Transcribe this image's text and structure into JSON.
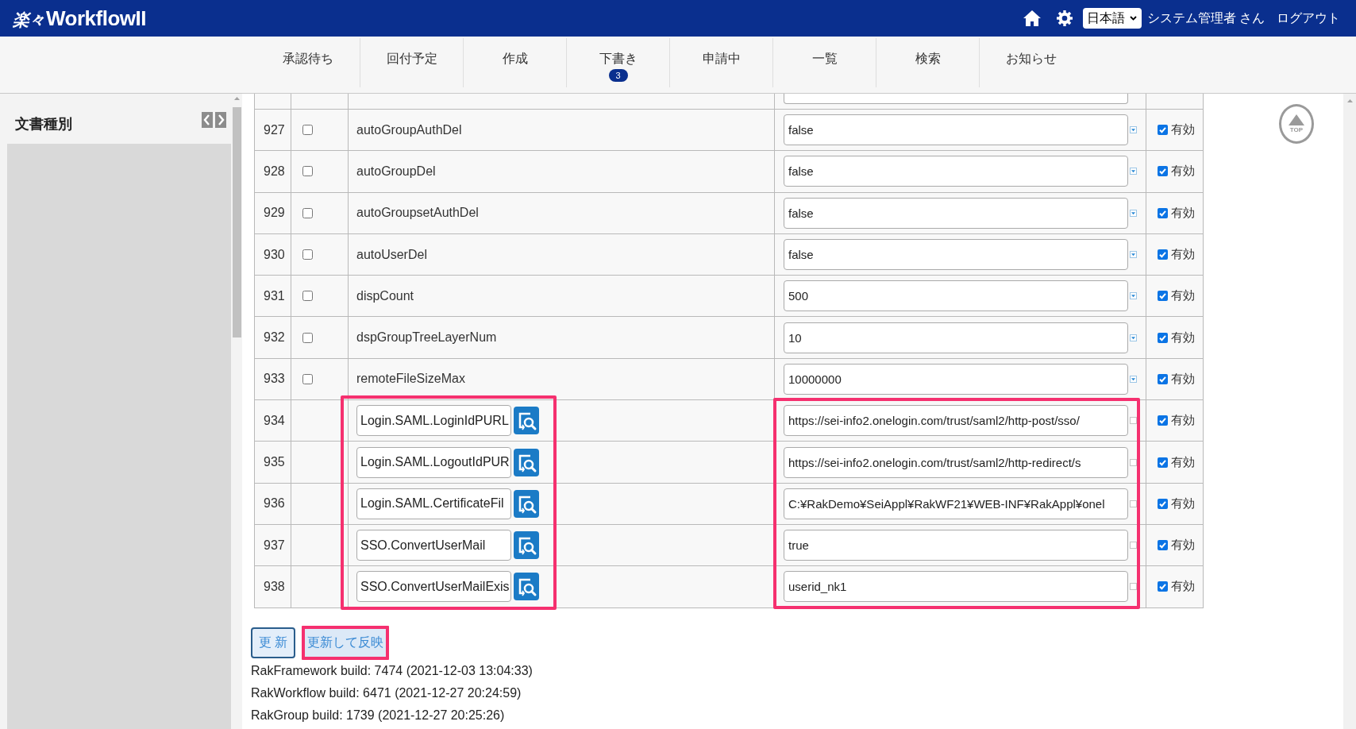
{
  "header": {
    "logo": {
      "mark": "楽々",
      "name": "WorkflowII"
    },
    "language": "日本語",
    "user": "システム管理者 さん",
    "logout": "ログアウト"
  },
  "nav": {
    "tabs": [
      {
        "label": "承認待ち",
        "selected": false
      },
      {
        "label": "回付予定",
        "selected": false
      },
      {
        "label": "作成",
        "selected": false
      },
      {
        "label": "下書き",
        "selected": false,
        "badge": "3"
      },
      {
        "label": "申請中",
        "selected": false
      },
      {
        "label": "一覧",
        "selected": false
      },
      {
        "label": "検索",
        "selected": false
      },
      {
        "label": "お知らせ",
        "selected": false
      }
    ]
  },
  "sidebar": {
    "title": "文書種別"
  },
  "table": {
    "rows": [
      {
        "kind": "cut"
      },
      {
        "kind": "fixed",
        "number": "927",
        "checked": false,
        "name": "autoGroupAuthDel",
        "value": "false",
        "enable": {
          "label": "有効",
          "checked": true
        },
        "name_highlighted": false,
        "value_highlighted": false
      },
      {
        "kind": "fixed",
        "number": "928",
        "checked": false,
        "name": "autoGroupDel",
        "value": "false",
        "enable": {
          "label": "有効",
          "checked": true
        },
        "name_highlighted": false,
        "value_highlighted": false
      },
      {
        "kind": "fixed",
        "number": "929",
        "checked": false,
        "name": "autoGroupsetAuthDel",
        "value": "false",
        "enable": {
          "label": "有効",
          "checked": true
        },
        "name_highlighted": false,
        "value_highlighted": false
      },
      {
        "kind": "fixed",
        "number": "930",
        "checked": false,
        "name": "autoUserDel",
        "value": "false",
        "enable": {
          "label": "有効",
          "checked": true
        },
        "name_highlighted": false,
        "value_highlighted": false
      },
      {
        "kind": "fixed",
        "number": "931",
        "checked": false,
        "name": "dispCount",
        "value": "500",
        "enable": {
          "label": "有効",
          "checked": true
        },
        "name_highlighted": false,
        "value_highlighted": false
      },
      {
        "kind": "fixed",
        "number": "932",
        "checked": false,
        "name": "dspGroupTreeLayerNum",
        "value": "10",
        "enable": {
          "label": "有効",
          "checked": true
        },
        "name_highlighted": false,
        "value_highlighted": false
      },
      {
        "kind": "fixed",
        "number": "933",
        "checked": false,
        "name": "remoteFileSizeMax",
        "value": "10000000",
        "enable": {
          "label": "有効",
          "checked": true
        },
        "name_highlighted": false,
        "value_highlighted": false
      },
      {
        "kind": "custom",
        "number": "934",
        "name": "Login.SAML.LoginIdPURL",
        "value": "https://sei-info2.onelogin.com/trust/saml2/http-post/sso/",
        "enable": {
          "label": "有効",
          "checked": true
        },
        "name_highlighted": true,
        "value_highlighted": true
      },
      {
        "kind": "custom",
        "number": "935",
        "name": "Login.SAML.LogoutIdPUR",
        "value": "https://sei-info2.onelogin.com/trust/saml2/http-redirect/s",
        "enable": {
          "label": "有効",
          "checked": true
        },
        "name_highlighted": true,
        "value_highlighted": true
      },
      {
        "kind": "custom",
        "number": "936",
        "name": "Login.SAML.CertificateFil",
        "value": "C:¥RakDemo¥SeiAppl¥RakWF21¥WEB-INF¥RakAppl¥onel",
        "enable": {
          "label": "有効",
          "checked": true
        },
        "name_highlighted": true,
        "value_highlighted": true
      },
      {
        "kind": "custom",
        "number": "937",
        "name": "SSO.ConvertUserMail",
        "value": "true",
        "enable": {
          "label": "有効",
          "checked": true
        },
        "name_highlighted": true,
        "value_highlighted": true
      },
      {
        "kind": "custom",
        "number": "938",
        "name": "SSO.ConvertUserMailExis",
        "value": "userid_nk1",
        "enable": {
          "label": "有効",
          "checked": true
        },
        "name_highlighted": true,
        "value_highlighted": true
      }
    ]
  },
  "buttons": [
    {
      "label": "更 新",
      "highlighted": false
    },
    {
      "label": "更新して反映",
      "highlighted": true
    }
  ],
  "build_info": [
    "RakFramework build: 7474 (2021-12-03 13:04:33)",
    "RakWorkflow build: 6471 (2021-12-27 20:24:59)",
    "RakGroup build: 1739 (2021-12-27 20:25:26)"
  ],
  "top_button": {
    "label": "TOP"
  }
}
